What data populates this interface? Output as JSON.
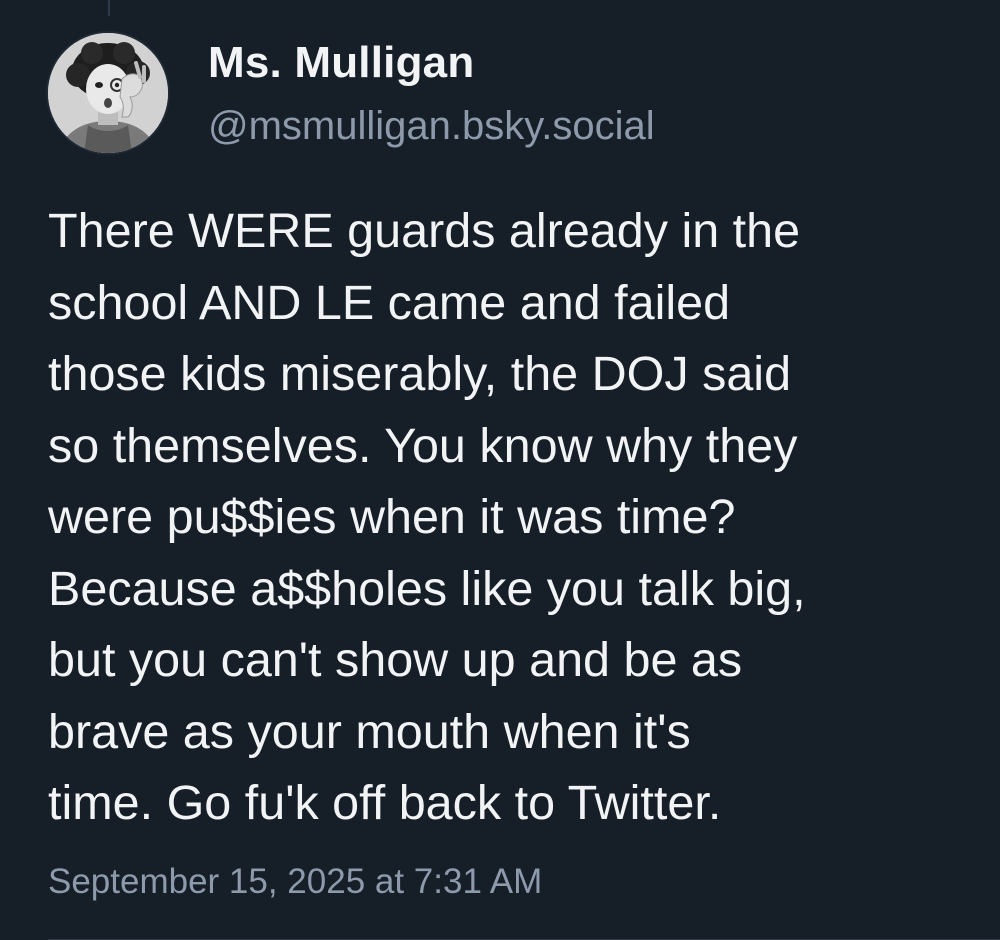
{
  "post": {
    "author": {
      "display_name": "Ms. Mulligan",
      "handle": "@msmulligan.bsky.social",
      "avatar_icon": "avatar-portrait"
    },
    "text_lines": [
      "There WERE guards already in the",
      "school AND LE came and failed",
      "those kids miserably, the DOJ said",
      "so themselves. You know why they",
      "were pu$$ies when it was time?",
      "Because a$$holes like you talk big,",
      "but you can't show up and be as",
      "brave as your mouth when it's",
      "time. Go fu'k off back to Twitter."
    ],
    "timestamp": "September 15, 2025 at 7:31 AM"
  },
  "colors": {
    "background": "#161e27",
    "primary_text": "#f1f3f5",
    "secondary_text": "#8d9aab",
    "divider": "#2e3a47"
  }
}
